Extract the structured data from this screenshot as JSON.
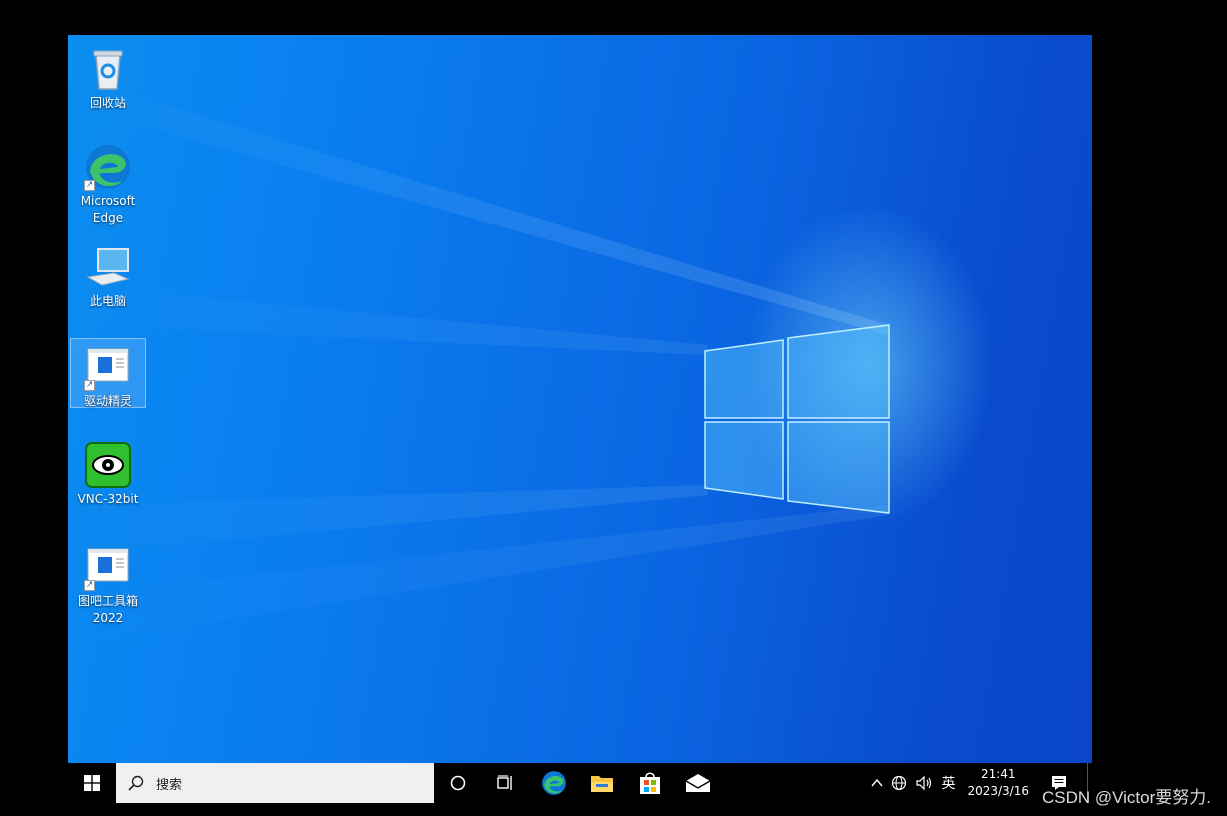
{
  "desktop": {
    "icons": [
      {
        "label": "回收站",
        "icon": "recycle-bin-icon"
      },
      {
        "label": "Microsoft Edge",
        "icon": "edge-icon"
      },
      {
        "label": "此电脑",
        "icon": "this-pc-icon"
      },
      {
        "label": "驱动精灵",
        "icon": "app-window-icon"
      },
      {
        "label": "VNC-32bit",
        "icon": "vnc-eye-icon"
      },
      {
        "label": "图吧工具箱2022",
        "icon": "app-window-icon"
      }
    ]
  },
  "taskbar": {
    "search_placeholder": "搜索",
    "pinned": [
      "cortana-icon",
      "task-view-icon",
      "edge-icon",
      "file-explorer-icon",
      "store-icon",
      "mail-icon"
    ],
    "tray": {
      "ime": "英",
      "time": "21:41",
      "date": "2023/3/16"
    }
  },
  "watermark": "CSDN @Victor要努力.",
  "colors": {
    "wallpaper_light": "#0b8ef0",
    "wallpaper_dark": "#0a45c6",
    "taskbar": "#000000",
    "search_box": "#f0f0f0"
  }
}
